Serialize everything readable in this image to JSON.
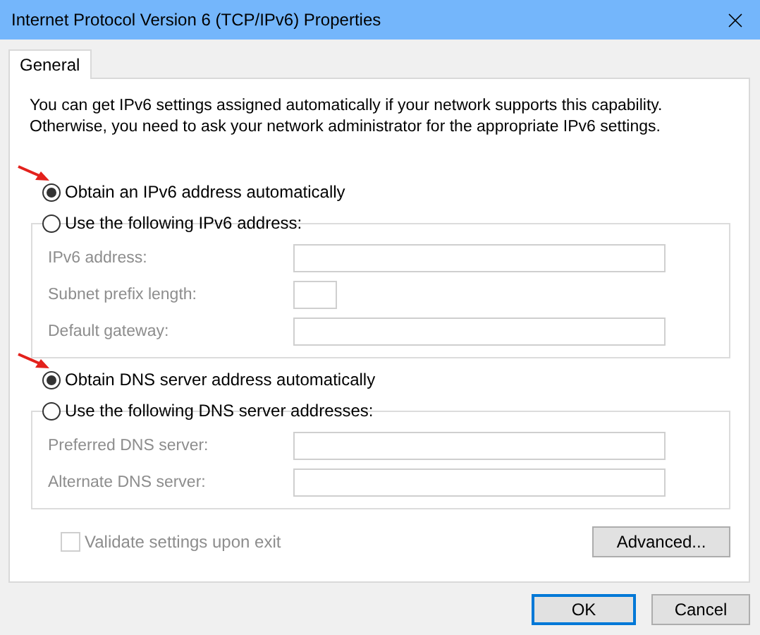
{
  "window": {
    "title": "Internet Protocol Version 6 (TCP/IPv6) Properties"
  },
  "tabs": [
    {
      "label": "General",
      "selected": true
    }
  ],
  "description": "You can get IPv6 settings assigned automatically if your network supports this capability.\nOtherwise, you need to ask your network administrator for the appropriate IPv6 settings.",
  "sections": [
    {
      "auto_option": {
        "label": "Obtain an IPv6 address automatically",
        "selected": true,
        "arrow": true
      },
      "manual_option": {
        "label": "Use the following IPv6 address:",
        "selected": false
      },
      "fields": [
        {
          "label": "IPv6 address:",
          "kind": "wide",
          "disabled": true
        },
        {
          "label": "Subnet prefix length:",
          "kind": "short",
          "disabled": true
        },
        {
          "label": "Default gateway:",
          "kind": "wide",
          "disabled": true
        }
      ]
    },
    {
      "auto_option": {
        "label": "Obtain DNS server address automatically",
        "selected": true,
        "arrow": true
      },
      "manual_option": {
        "label": "Use the following DNS server addresses:",
        "selected": false
      },
      "fields": [
        {
          "label": "Preferred DNS server:",
          "kind": "wide",
          "disabled": true
        },
        {
          "label": "Alternate DNS server:",
          "kind": "wide",
          "disabled": true
        }
      ]
    }
  ],
  "validate": {
    "label": "Validate settings upon exit",
    "checked": false,
    "disabled": true
  },
  "advanced_button": "Advanced...",
  "buttons": [
    {
      "label": "OK",
      "default": true
    },
    {
      "label": "Cancel",
      "default": false
    }
  ]
}
